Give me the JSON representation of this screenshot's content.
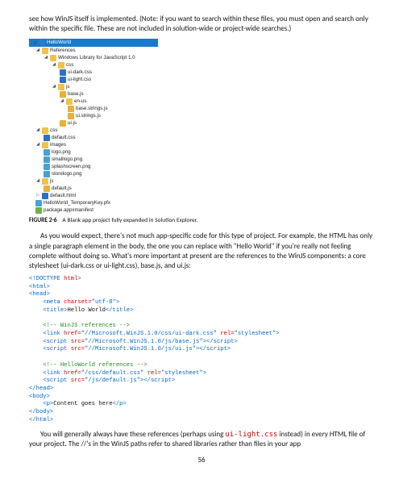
{
  "intro_text": "see how WinJS itself is implemented. (Note: if you want to search within these files, you must open and search only within the specific file. These are not included in solution-wide or project-wide searches.)",
  "tree": {
    "root": "HelloWorld",
    "references": "References",
    "winlib": "Windows Library for JavaScript 1.0",
    "css_folder": "css",
    "css_dark": "ui-dark.css",
    "css_light": "ui-light.css",
    "js_folder": "js",
    "js_base": "base.js",
    "js_enus": "en-us",
    "js_base_strings": "base.strings.js",
    "js_ui_strings": "ui.strings.js",
    "js_ui": "ui.js",
    "css_folder2": "css",
    "css_default": "default.css",
    "images_folder": "images",
    "img_logo": "logo.png",
    "img_smalllogo": "smalllogo.png",
    "img_splash": "splashscreen.png",
    "img_storelogo": "storelogo.png",
    "js_folder2": "js",
    "js_default": "default.js",
    "default_html": "default.html",
    "cert": "HelloWorld_TemporaryKey.pfx",
    "manifest": "package.appxmanifest"
  },
  "caption_label": "FIGURE 2-6",
  "caption_text": "A Blank app project fully expanded in Solution Explorer.",
  "para1": "As you would expect, there's not much app-specific code for this type of project. For example, the HTML has only a single paragraph element in the body, the one you can replace with \"Hello World\" if you're really not feeling complete without doing so. What's more important at present are the references to the WinJS components: a core stylesheet (ui-dark.css or ui-light.css), base.js, and ui.js:",
  "code": {
    "doctype_open": "<!DOCTYPE ",
    "doctype": "<!DOCTYPE html>",
    "html_kw": "html",
    "html_open": "<html>",
    "head_open": "<head>",
    "meta_tag": "<meta ",
    "meta": "    <meta charset=\"utf-8\">",
    "meta_attr": "charset=",
    "meta_val": "\"utf-8\"",
    "title_open": "    <title>",
    "title_text": "Hello World",
    "title_close": "</title>",
    "comment1": "    <!-- WinJS references -->",
    "link1": "    <link href=\"//Microsoft.WinJS.1.0/css/ui-dark.css\" rel=\"stylesheet\">",
    "link1_href": "\"//Microsoft.WinJS.1.0/css/ui-dark.css\"",
    "link1_rel": "\"stylesheet\"",
    "script1": "    <script src=\"//Microsoft.WinJS.1.0/js/base.js\"></script>",
    "script1_src": "\"//Microsoft.WinJS.1.0/js/base.js\"",
    "script2": "    <script src=\"//Microsoft.WinJS.1.0/js/ui.js\"></script>",
    "script2_src": "\"//Microsoft.WinJS.1.0/js/ui.js\"",
    "comment2": "    <!-- HelloWorld references -->",
    "link2": "    <link href=\"/css/default.css\" rel=\"stylesheet\">",
    "link2_href": "\"/css/default.css\"",
    "link2_rel": "\"stylesheet\"",
    "script3": "    <script src=\"/js/default.js\"></script>",
    "script3_src": "\"/js/default.js\"",
    "head_close": "</head>",
    "body_open": "<body>",
    "p_open": "    <p>",
    "p_text": "Content goes here",
    "p_close": "</p>",
    "body_close": "</body>",
    "html_close": "</html>"
  },
  "para2_a": "You will generally always have these references (perhaps using ",
  "para2_code": "ui-light.css",
  "para2_b": " instead) in every HTML file of your project. The //'s in the WinJS paths refer to shared libraries rather than files in your app",
  "page_number": "56"
}
